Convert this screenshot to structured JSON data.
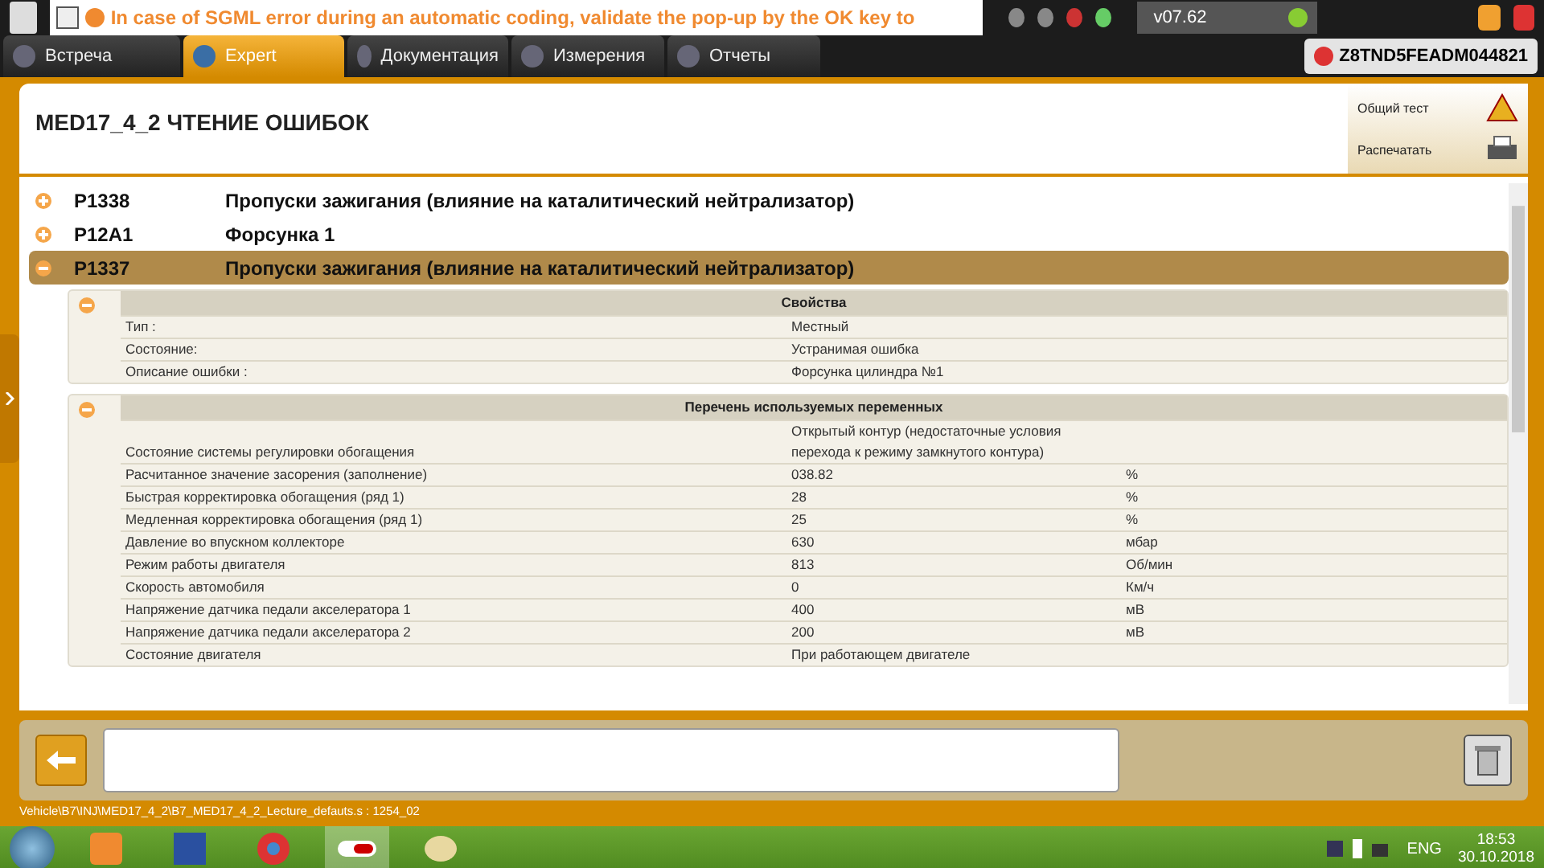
{
  "header": {
    "banner": "In case of SGML error during an automatic coding, validate the pop-up by the OK key to",
    "version": "v07.62",
    "vin": "Z8TND5FEADM044821"
  },
  "tabs": [
    {
      "label": "Встреча",
      "selected": false
    },
    {
      "label": "Expert",
      "selected": true
    },
    {
      "label": "Документация",
      "selected": false
    },
    {
      "label": "Измерения",
      "selected": false
    },
    {
      "label": "Отчеты",
      "selected": false
    }
  ],
  "page": {
    "title": "MED17_4_2  ЧТЕНИЕ ОШИБОК",
    "actions": [
      "Общий тест",
      "Распечатать"
    ]
  },
  "faults": [
    {
      "code": "P1338",
      "description": "Пропуски зажигания (влияние на каталитический нейтрализатор)",
      "expanded": false
    },
    {
      "code": "P12A1",
      "description": "Форсунка 1",
      "expanded": false
    },
    {
      "code": "P1337",
      "description": "Пропуски зажигания (влияние на каталитический нейтрализатор)",
      "expanded": true,
      "sections": [
        {
          "title": "Свойства",
          "expanded": true,
          "rows": [
            {
              "label": "Тип :",
              "value": "Местный"
            },
            {
              "label": "Состояние:",
              "value": "Устранимая ошибка"
            },
            {
              "label": "Описание ошибки :",
              "value": "Форсунка цилиндра №1"
            }
          ]
        },
        {
          "title": "Перечень используемых переменных",
          "expanded": true,
          "rows": [
            {
              "label": "Состояние системы регулировки обогащения",
              "value": "Открытый контур (недостаточные условия перехода к режиму замкнутого контура)"
            },
            {
              "label": "Расчитанное значение засорения (заполнение)",
              "value": "038.82",
              "unit": "%"
            },
            {
              "label": "Быстрая корректировка обогащения (ряд 1)",
              "value": "28",
              "unit": "%"
            },
            {
              "label": "Медленная корректировка обогащения (ряд 1)",
              "value": "25",
              "unit": "%"
            },
            {
              "label": "Давление во впускном коллекторе",
              "value": "630",
              "unit": "мбар"
            },
            {
              "label": "Режим работы двигателя",
              "value": "813",
              "unit": "Об/мин"
            },
            {
              "label": "Скорость автомобиля",
              "value": "0",
              "unit": "Км/ч"
            },
            {
              "label": "Напряжение датчика педали акселератора 1",
              "value": "400",
              "unit": "мВ"
            },
            {
              "label": "Напряжение датчика педали акселератора 2",
              "value": "200",
              "unit": "мВ"
            },
            {
              "label": "Состояние двигателя",
              "value": "При работающем двигателе"
            }
          ]
        }
      ]
    }
  ],
  "footer": {
    "path": "Vehicle\\B7\\INJ\\MED17_4_2\\B7_MED17_4_2_Lecture_defauts.s : 1254_02"
  },
  "taskbar": {
    "language": "ENG",
    "time": "18:53",
    "date": "30.10.2018"
  }
}
